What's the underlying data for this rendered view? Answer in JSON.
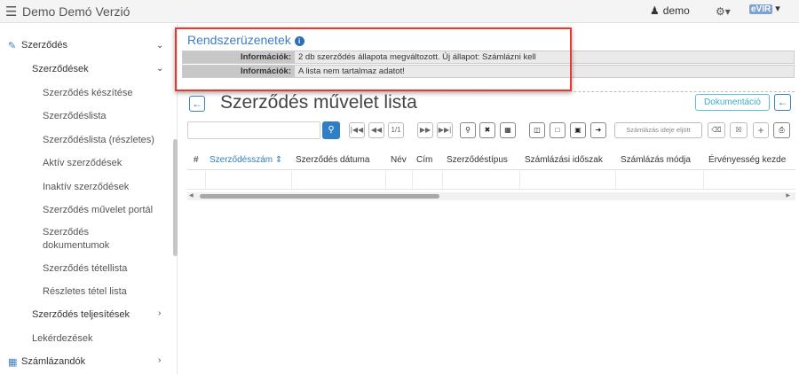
{
  "app": {
    "title": "Demo Demó Verzió",
    "user": "demo",
    "logo_text": "eVIR"
  },
  "sidebar": {
    "items": [
      {
        "label": "Szerződés"
      },
      {
        "label": "Szerződések"
      },
      {
        "label": "Szerződés készítése"
      },
      {
        "label": "Szerződéslista"
      },
      {
        "label": "Szerződéslista (részletes)"
      },
      {
        "label": "Aktív szerződések"
      },
      {
        "label": "Inaktív szerződések"
      },
      {
        "label": "Szerződés művelet portál"
      },
      {
        "label": "Szerződés"
      },
      {
        "label": "dokumentumok"
      },
      {
        "label": "Szerződés tétellista"
      },
      {
        "label": "Részletes tétel lista"
      },
      {
        "label": "Szerződés teljesítések"
      },
      {
        "label": "Lekérdezések"
      },
      {
        "label": "Számlázandók"
      }
    ]
  },
  "messages": {
    "title": "Rendszerüzenetek",
    "rows": [
      {
        "label": "Információk:",
        "text": "2 db szerződés állapota megváltozott. Új állapot: Számlázni kell"
      },
      {
        "label": "Információk:",
        "text": "A lista nem tartalmaz adatot!"
      }
    ]
  },
  "page": {
    "title": "Szerződés művelet lista",
    "doc_button": "Dokumentáció"
  },
  "toolbar": {
    "pager": "1/1",
    "billing_due_label": "Számlázás ideje eljött"
  },
  "table": {
    "columns": [
      "#",
      "Szerződésszám",
      "Szerződés dátuma",
      "Név",
      "Cím",
      "Szerződéstípus",
      "Számlázási időszak",
      "Számlázás módja",
      "Érvényesség kezde"
    ]
  },
  "colors": {
    "accent": "#2f7fc6",
    "highlight": "#e53a32",
    "doc_button": "#3aaec8"
  }
}
